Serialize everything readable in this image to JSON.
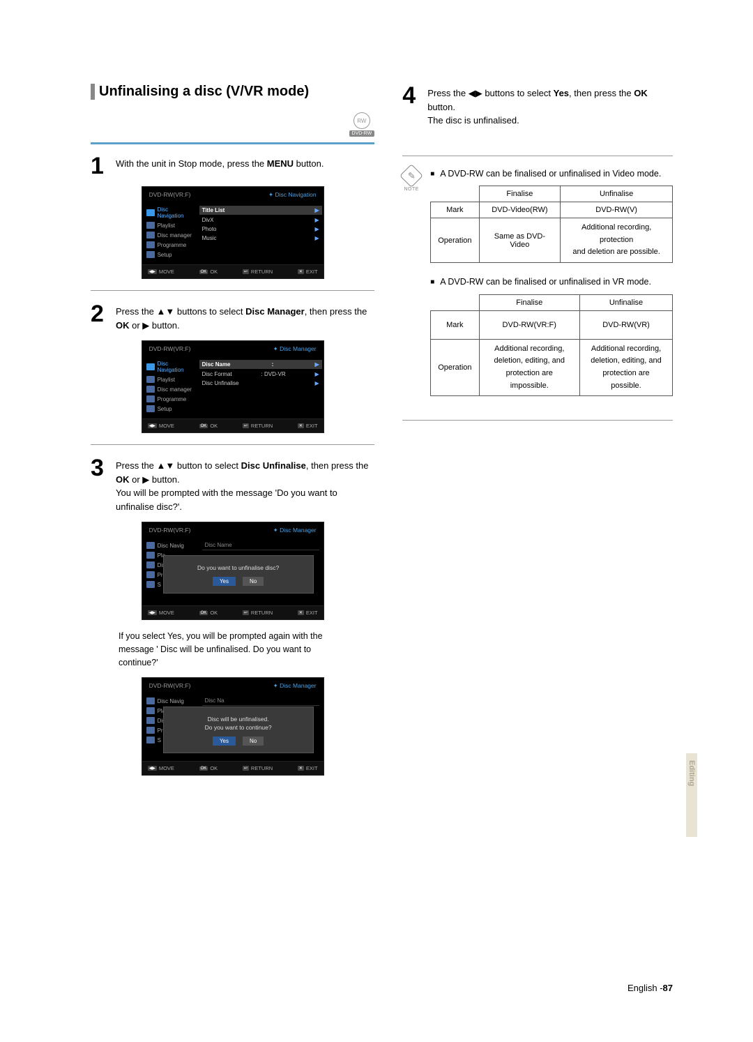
{
  "section_title": "Unfinalising a disc (V/VR mode)",
  "dvd_rw_label": "DVD-RW",
  "steps": {
    "s1": {
      "num": "1",
      "text_a": "With the unit in Stop mode, press the ",
      "text_b": "MENU",
      "text_c": " button."
    },
    "s2": {
      "num": "2",
      "text_a": "Press the ▲▼ buttons to select ",
      "text_b": "Disc Manager",
      "text_c": ", then press the ",
      "text_d": "OK",
      "text_e": " or ▶ button."
    },
    "s3": {
      "num": "3",
      "text_a": "Press the ▲▼ button to select ",
      "text_b": "Disc Unfinalise",
      "text_c": ", then press the ",
      "text_d": "OK",
      "text_e": " or ▶ button.",
      "sub": "You will be prompted with the message 'Do you want to unfinalise disc?'."
    },
    "s4": {
      "num": "4",
      "text_a": "Press the ◀▶ buttons to select ",
      "text_b": "Yes",
      "text_c": ", then press the ",
      "text_d": "OK",
      "text_e": " button.",
      "sub": "The disc is unfinalised."
    }
  },
  "caption1": "If you select Yes, you will be prompted again with the message ' Disc will be unfinalised. Do you want to continue?'",
  "osd": {
    "header_left": "DVD-RW(VR:F)",
    "header_right_nav": "Disc Navigation",
    "header_right_mgr": "Disc Manager",
    "nav": {
      "disc_navigation": "Disc Navigation",
      "playlist": "Playlist",
      "disc_manager": "Disc manager",
      "programme": "Programme",
      "setup": "Setup"
    },
    "nav_short": {
      "disc_navigation": "Disc Navig",
      "playlist": "Pla",
      "disc_manager": "Disc man",
      "programme": "Progra",
      "setup": "S"
    },
    "main1": {
      "title_list": "Title List",
      "divx": "DivX",
      "photo": "Photo",
      "music": "Music"
    },
    "main2": {
      "disc_name": "Disc Name",
      "disc_format": "Disc Format",
      "disc_format_val": ": DVD-VR",
      "disc_unfinalise": "Disc Unfinalise"
    },
    "dialog1": {
      "title_row": "Disc Name",
      "msg": "Do you want to unfinalise disc?",
      "yes": "Yes",
      "no": "No"
    },
    "dialog2": {
      "title_row": "Disc Na",
      "msg1": "Disc will be unfinalised.",
      "msg2": "Do you want to continue?",
      "yes": "Yes",
      "no": "No"
    },
    "foot": {
      "move": "MOVE",
      "ok": "OK",
      "return": "RETURN",
      "exit": "EXIT"
    }
  },
  "note_label": "NOTE",
  "notes": {
    "n1": "A DVD-RW can be finalised or unfinalised in Video mode.",
    "n2": "A DVD-RW can be finalised or unfinalised in VR mode."
  },
  "table1": {
    "h_finalise": "Finalise",
    "h_unfinalise": "Unfinalise",
    "r1_label": "Mark",
    "r1_c1": "DVD-Video(RW)",
    "r1_c2": "DVD-RW(V)",
    "r2_label": "Operation",
    "r2_c1": "Same as DVD-Video",
    "r2_c2a": "Additional recording, protection",
    "r2_c2b": "and deletion are possible."
  },
  "table2": {
    "h_finalise": "Finalise",
    "h_unfinalise": "Unfinalise",
    "r1_label": "Mark",
    "r1_c1": "DVD-RW(VR:F)",
    "r1_c2": "DVD-RW(VR)",
    "r2_label": "Operation",
    "r2_c1a": "Additional recording,",
    "r2_c1b": "deletion, editing, and",
    "r2_c1c": "protection are impossible.",
    "r2_c2a": "Additional recording,",
    "r2_c2b": "deletion, editing, and",
    "r2_c2c": "protection are possible."
  },
  "side_tab": "Editing",
  "footer_lang": "English -",
  "footer_page": "87"
}
